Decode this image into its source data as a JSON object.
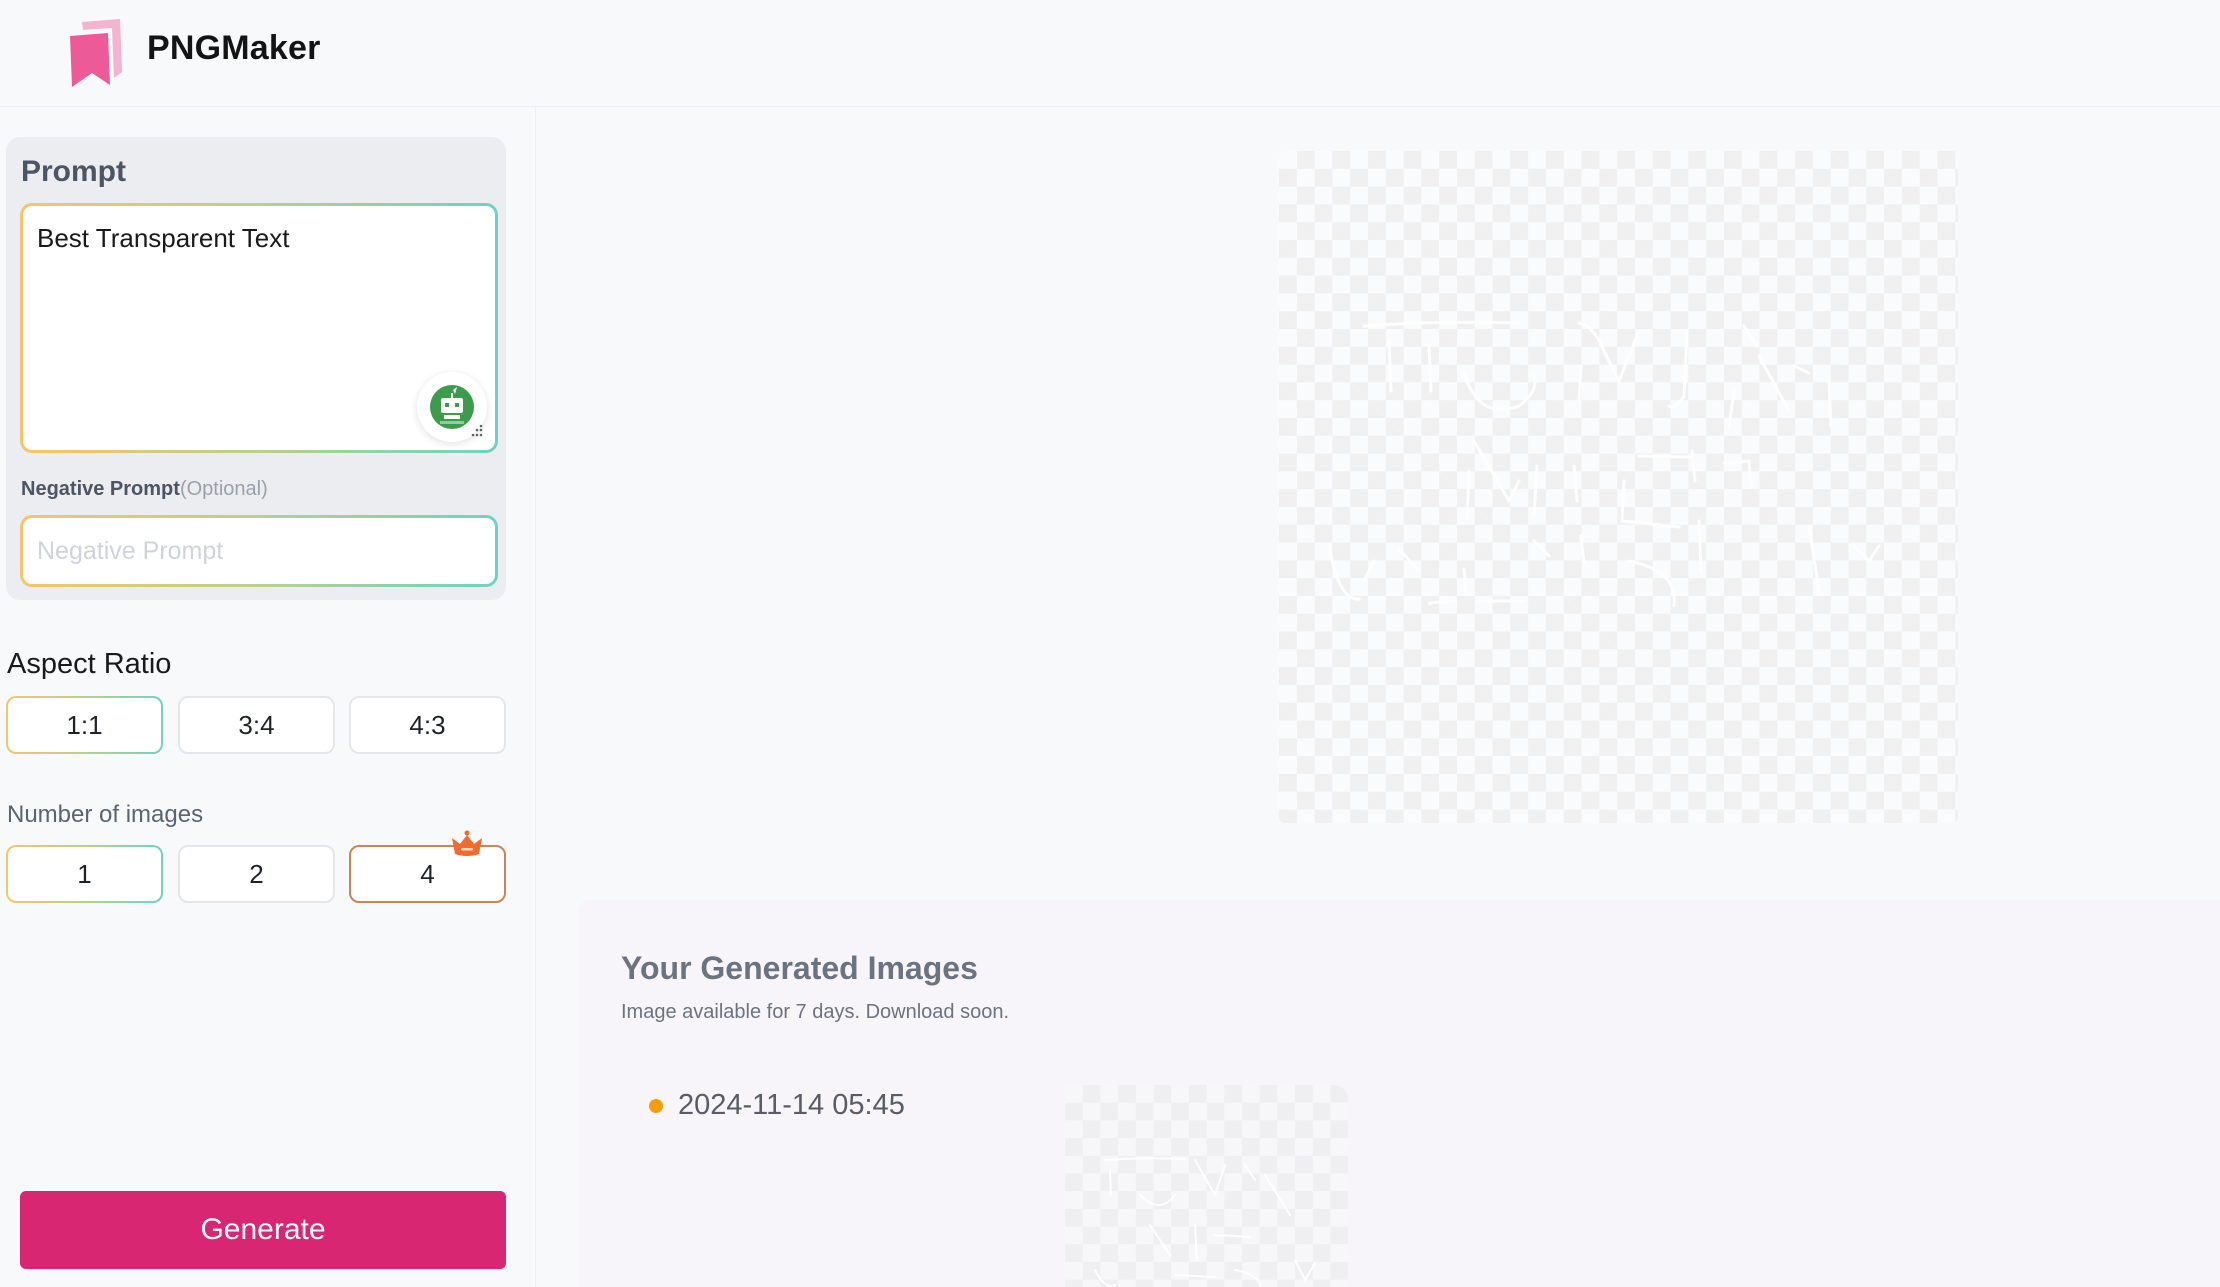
{
  "header": {
    "brand": "PNGMaker",
    "logo_icon": "bookmark-stack-icon",
    "colors": {
      "logo_front": "#ec5a98",
      "logo_back": "#f4b3cf"
    }
  },
  "form": {
    "prompt": {
      "label": "Prompt",
      "value": "Best Transparent Text",
      "ai_button_icon": "robot-assistant-icon"
    },
    "negative_prompt": {
      "label": "Negative Prompt",
      "optional_label": "(Optional)",
      "value": "",
      "placeholder": "Negative Prompt"
    },
    "aspect_ratio": {
      "label": "Aspect Ratio",
      "options": [
        {
          "label": "1:1",
          "selected": true
        },
        {
          "label": "3:4",
          "selected": false
        },
        {
          "label": "4:3",
          "selected": false
        }
      ]
    },
    "number_of_images": {
      "label": "Number of images",
      "options": [
        {
          "label": "1",
          "selected": true,
          "premium": false
        },
        {
          "label": "2",
          "selected": false,
          "premium": false
        },
        {
          "label": "4",
          "selected": false,
          "premium": true,
          "badge_icon": "crown-icon"
        }
      ]
    },
    "generate_label": "Generate",
    "colors": {
      "generate": "#d92672",
      "selected_gradient_start": "#f8c46a",
      "selected_gradient_end": "#6ed2c0",
      "premium_border": "#c8845c",
      "crown": "#f26a2e"
    }
  },
  "preview": {
    "type": "transparent-png",
    "content_description": "Faint white handwritten text on transparent background"
  },
  "generated": {
    "title": "Your Generated Images",
    "subtitle": "Image available for 7 days. Download soon.",
    "entries": [
      {
        "timestamp": "2024-11-14 05:45",
        "status_color": "#f59e0b"
      }
    ]
  }
}
